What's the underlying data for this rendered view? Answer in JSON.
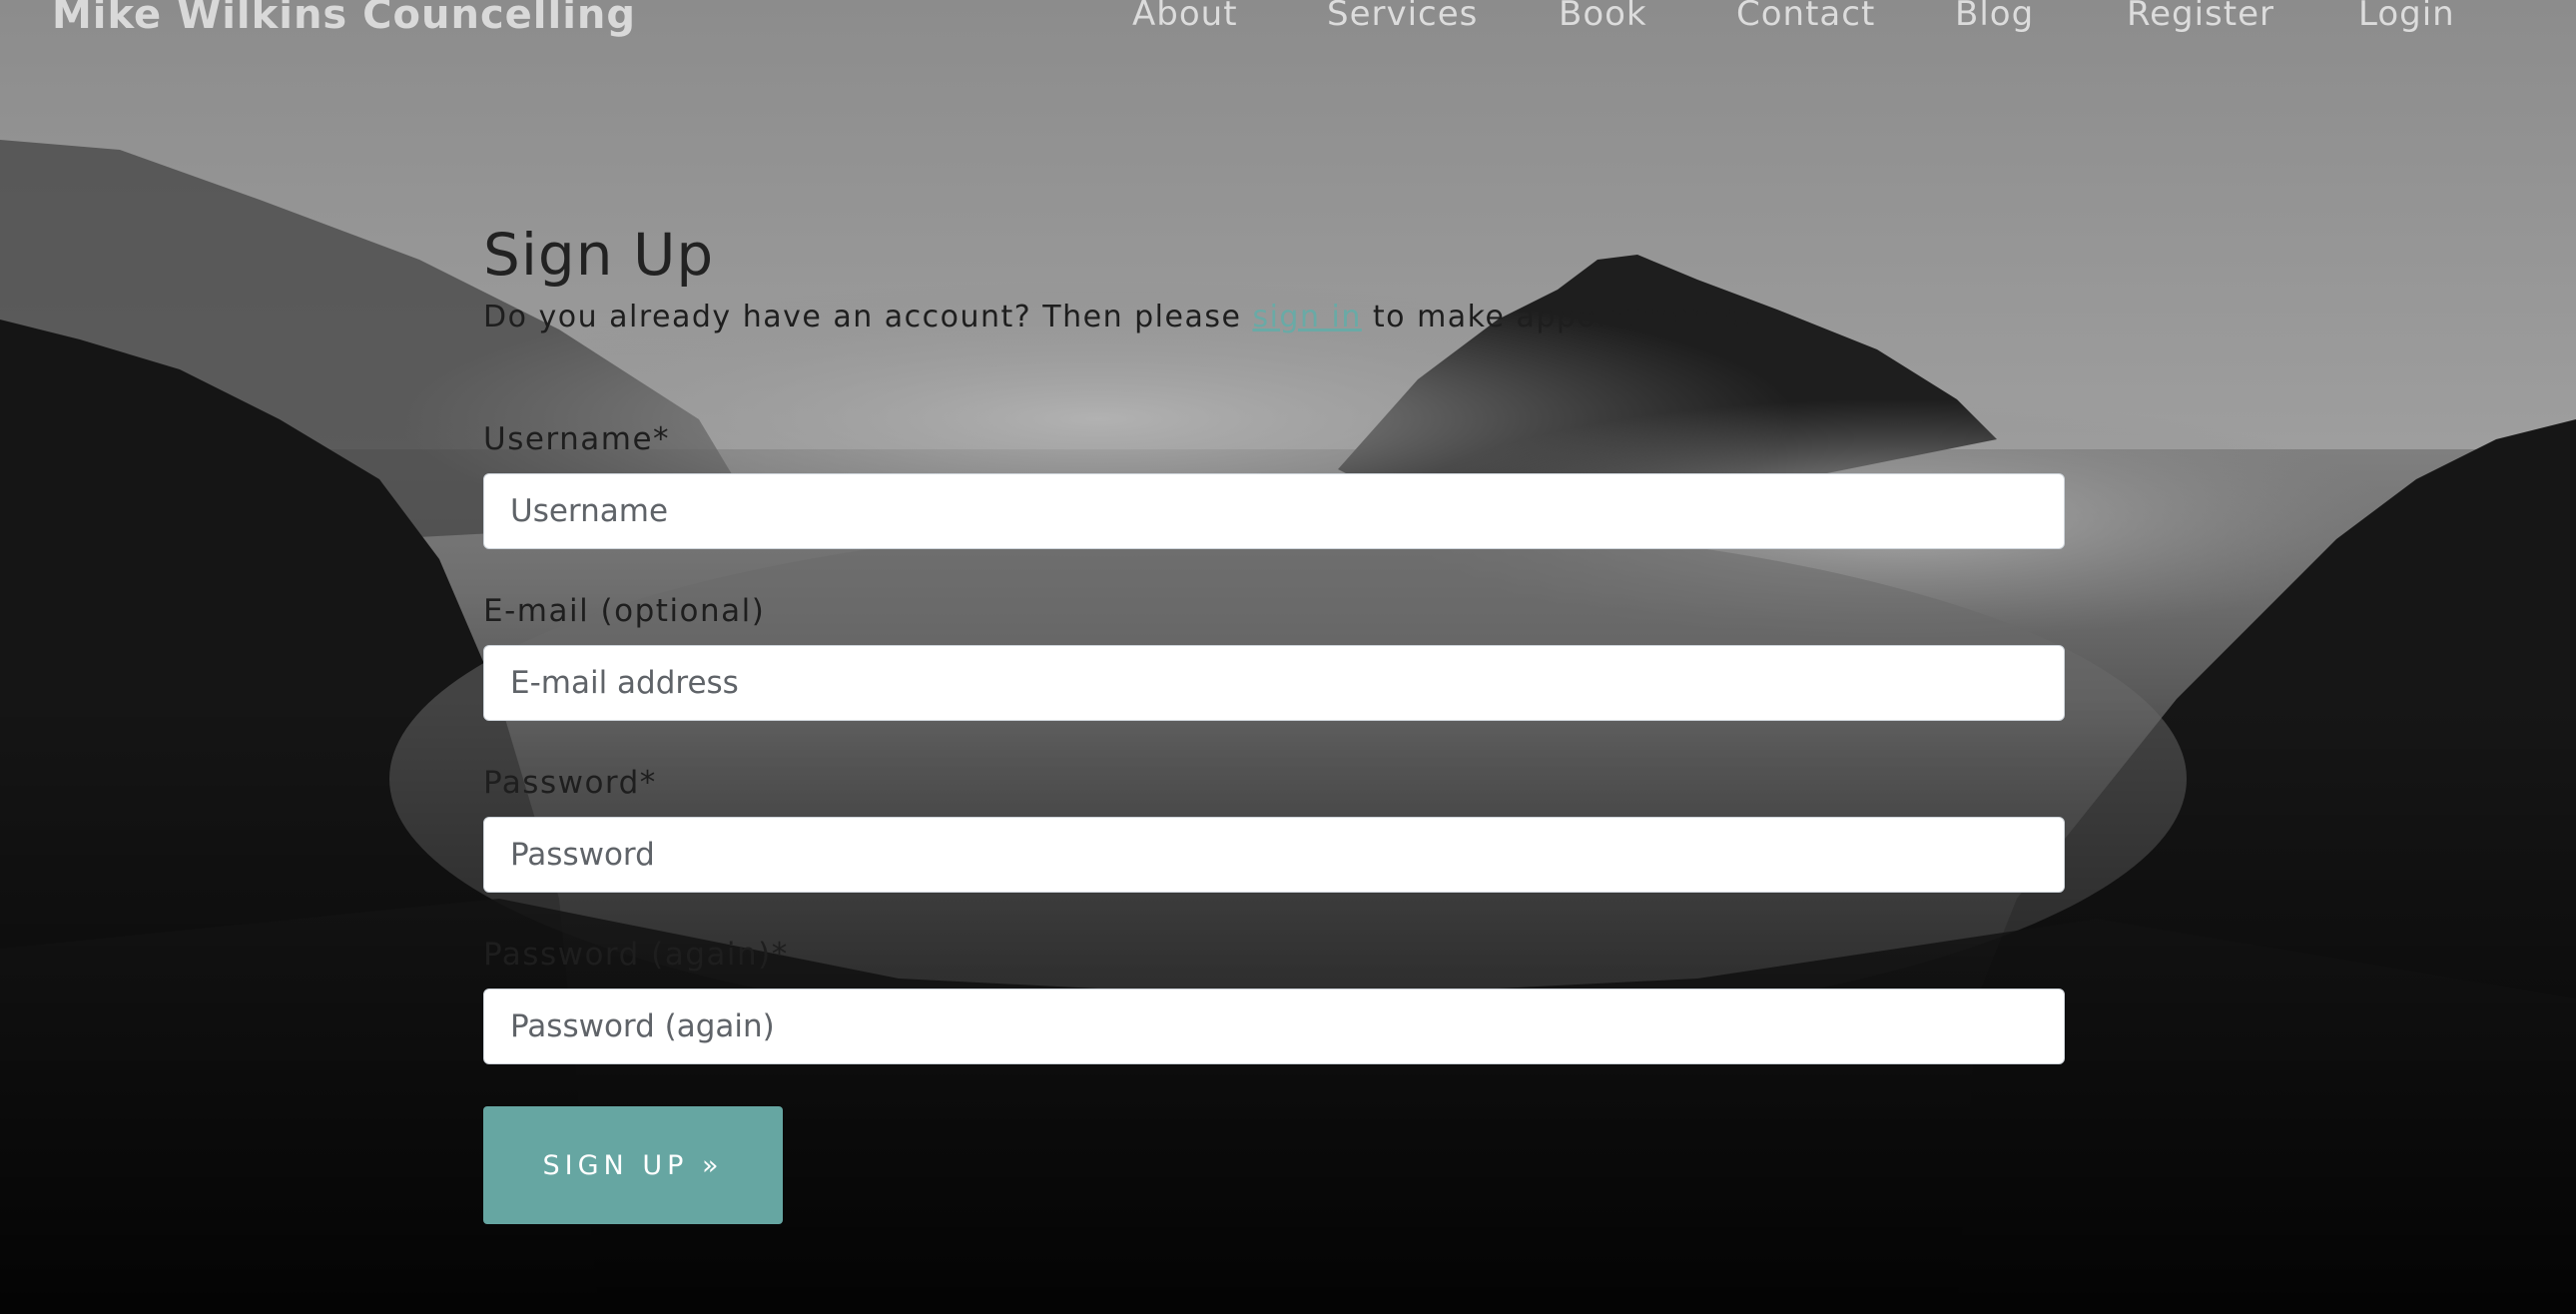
{
  "navbar": {
    "brand": "Mike Wilkins Councelling",
    "items": [
      {
        "label": "About"
      },
      {
        "label": "Services"
      },
      {
        "label": "Book"
      },
      {
        "label": "Contact"
      },
      {
        "label": "Blog"
      },
      {
        "label": "Register"
      },
      {
        "label": "Login"
      }
    ]
  },
  "form": {
    "title": "Sign Up",
    "intro_before": "Do you already have an account? Then please ",
    "intro_link": "sign in",
    "intro_after": " to make appointments.",
    "fields": [
      {
        "label": "Username*",
        "placeholder": "Username",
        "value": ""
      },
      {
        "label": "E-mail (optional)",
        "placeholder": "E-mail address",
        "value": ""
      },
      {
        "label": "Password*",
        "placeholder": "Password",
        "value": ""
      },
      {
        "label": "Password (again)*",
        "placeholder": "Password (again)",
        "value": ""
      }
    ],
    "submit_label": "SIGN UP »"
  },
  "colors": {
    "accent": "#66a6a2",
    "link": "#69aaa6",
    "nav_text": "#dcdcdc"
  }
}
